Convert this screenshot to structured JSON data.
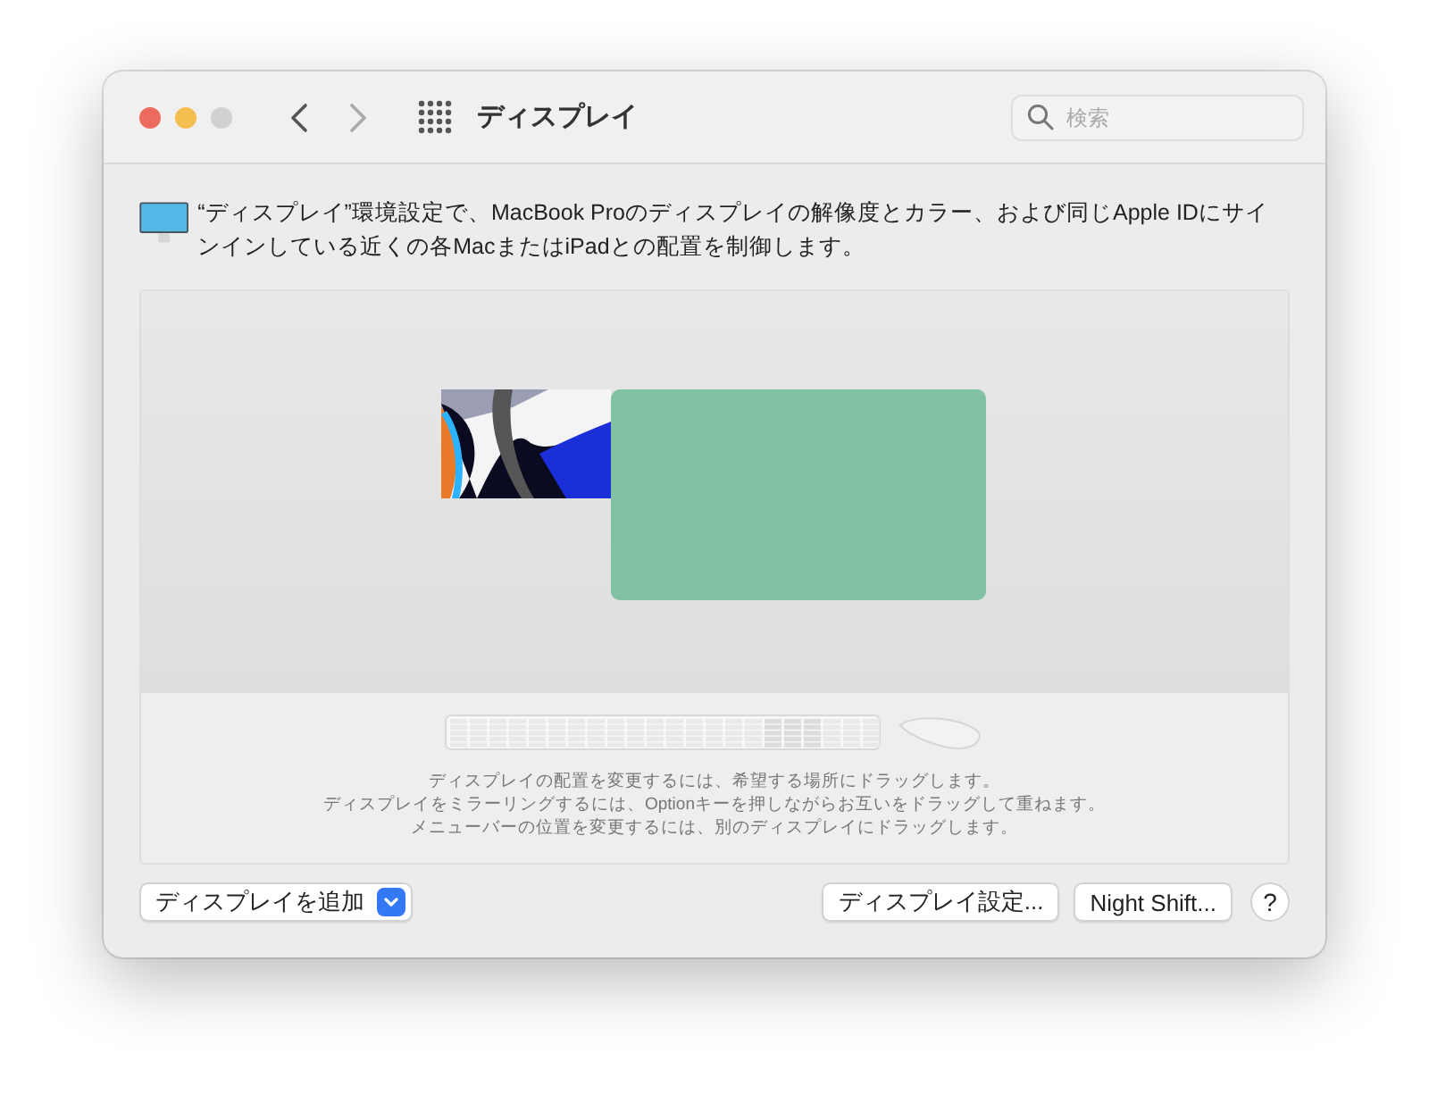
{
  "window": {
    "title": "ディスプレイ",
    "traffic_lights": [
      {
        "color": "#ed6a5e"
      },
      {
        "color": "#f5bf4f"
      },
      {
        "color": "#d0d0d0"
      }
    ]
  },
  "toolbar": {
    "back_enabled": true,
    "forward_enabled": false
  },
  "search": {
    "placeholder": "検索"
  },
  "description": "“ディスプレイ”環境設定で、MacBook Proのディスプレイの解像度とカラー、および同じApple IDにサインインしている近くの各MacまたはiPadとの配置を制御します。",
  "arrangement": {
    "displays": [
      {
        "kind": "picture"
      },
      {
        "kind": "solid",
        "color": "#80c2a3"
      }
    ],
    "hints": [
      "ディスプレイの配置を変更するには、希望する場所にドラッグします。",
      "ディスプレイをミラーリングするには、Optionキーを押しながらお互いをドラッグして重ねます。",
      "メニューバーの位置を変更するには、別のディスプレイにドラッグします。"
    ]
  },
  "add_display": {
    "label": "ディスプレイを追加"
  },
  "buttons": [
    {
      "kind": "text",
      "label": "ディスプレイ設定..."
    },
    {
      "kind": "text",
      "label": "Night Shift..."
    },
    {
      "kind": "help",
      "label": "?"
    }
  ]
}
